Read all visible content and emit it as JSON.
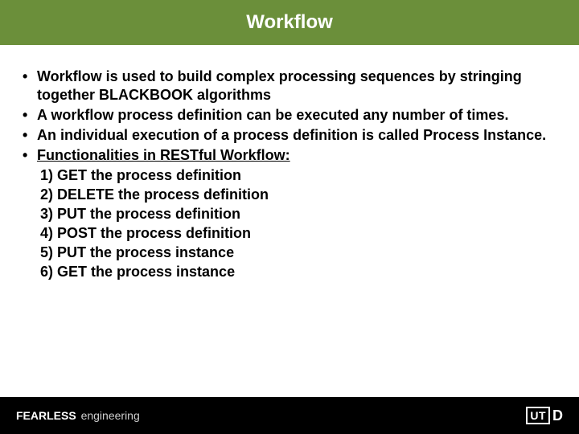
{
  "title": "Workflow",
  "bullets": [
    {
      "text": "Workflow is used to build complex processing sequences by stringing together BLACKBOOK algorithms",
      "underline": false
    },
    {
      "text": "A workflow process definition can be executed any number of times.",
      "underline": false
    },
    {
      "text": "An individual execution of a process definition is called Process Instance.",
      "underline": false
    },
    {
      "text": "Functionalities in RESTful Workflow:",
      "underline": true
    }
  ],
  "subitems": [
    "1) GET the process definition",
    "2) DELETE the process definition",
    "3) PUT the process definition",
    "4) POST the process definition",
    "5) PUT the process instance",
    "6) GET the process instance"
  ],
  "footer": {
    "brand_bold": "FEARLESS",
    "brand_light": "engineering",
    "logo_box": "UT",
    "logo_d": "D"
  }
}
